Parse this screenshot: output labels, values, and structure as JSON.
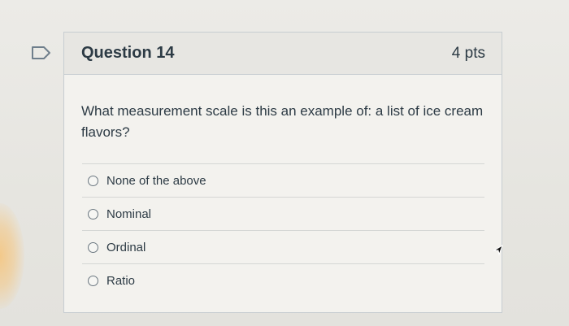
{
  "question": {
    "title": "Question 14",
    "points": "4 pts",
    "text": "What measurement scale is this an example of: a list of ice cream flavors?",
    "options": [
      {
        "label": "None of the above",
        "selected": false
      },
      {
        "label": "Nominal",
        "selected": false
      },
      {
        "label": "Ordinal",
        "selected": false
      },
      {
        "label": "Ratio",
        "selected": false
      }
    ]
  },
  "icons": {
    "bookmark": "bookmark-flag-icon",
    "cursor": "mouse-pointer-icon"
  },
  "colors": {
    "text": "#2d3b45",
    "header_bg": "#e7e6e2",
    "card_bg": "#f3f2ee",
    "border": "#c7cdd1"
  }
}
